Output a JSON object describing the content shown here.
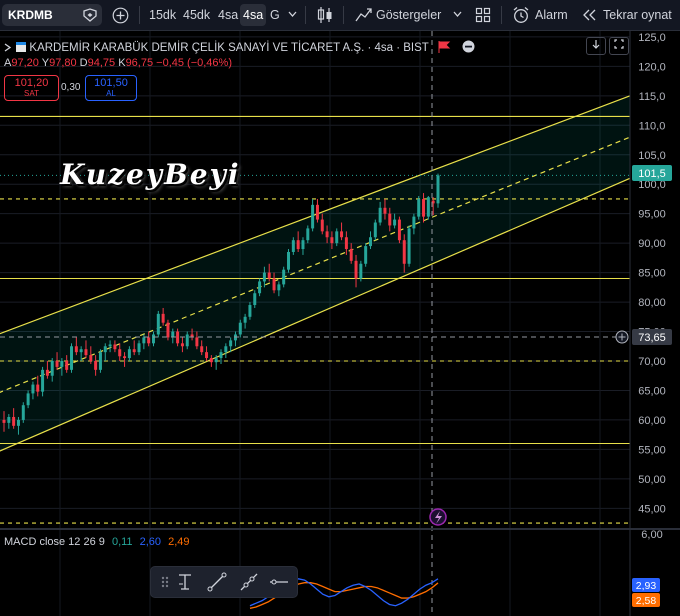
{
  "toolbar": {
    "symbol": "KRDMB",
    "intervals": [
      "15dk",
      "45dk",
      "4sa",
      "G"
    ],
    "active_interval": "4sa",
    "indicators_label": "Göstergeler",
    "alarm_label": "Alarm",
    "replay_label": "Tekrar oynat"
  },
  "legend": {
    "title": "KARDEMİR KARABÜK DEMİR ÇELİK SANAYİ VE TİCARET A.Ş. · 4sa · BIST",
    "ohlc": [
      {
        "k": "A",
        "v": "97,20"
      },
      {
        "k": "Y",
        "v": "97,80"
      },
      {
        "k": "D",
        "v": "94,75"
      },
      {
        "k": "K",
        "v": "96,75"
      }
    ],
    "change": "−0,45 (−0,46%)"
  },
  "trade": {
    "sell_price": "101,20",
    "sell_label": "SAT",
    "spread": "0,30",
    "buy_price": "101,50",
    "buy_label": "AL"
  },
  "watermark": "KuzeyBeyi",
  "price_axis": {
    "labels": [
      "125,0",
      "120,0",
      "115,0",
      "110,0",
      "105,0",
      "100,0",
      "95,00",
      "90,00",
      "85,00",
      "80,00",
      "75,00",
      "70,00",
      "65,00",
      "60,00",
      "55,00",
      "50,00",
      "45,00"
    ],
    "current_price": "101,5",
    "crosshair_price": "73,65"
  },
  "macd": {
    "label": "MACD close 12 26 9",
    "hist": "0,11",
    "macd": "2,60",
    "signal": "2,49",
    "axis_top": "6,00",
    "badge_blue": "2,93",
    "badge_orange": "2,58"
  },
  "colors": {
    "up": "#26a69a",
    "down": "#f23645",
    "level": "#e8e04a",
    "macd_line": "#2962ff",
    "signal_line": "#ff6d00"
  },
  "chart_data": {
    "type": "candlestick",
    "ylim": [
      42,
      126
    ],
    "horizontal_levels": [
      111.5,
      97.5,
      84,
      70,
      56,
      42.5
    ],
    "channel": {
      "upper": {
        "start": 74,
        "end": 115
      },
      "middle": {
        "start": 64,
        "end": 108
      },
      "lower": {
        "start": 54,
        "end": 101
      }
    },
    "candles": [
      [
        60,
        61.5,
        58,
        59.5
      ],
      [
        59.5,
        61,
        58.5,
        60.5
      ],
      [
        60.5,
        62,
        58.5,
        59
      ],
      [
        59,
        60.5,
        57.5,
        60
      ],
      [
        60,
        63,
        59.5,
        62.5
      ],
      [
        62.5,
        65,
        62,
        64.5
      ],
      [
        64.5,
        66.5,
        63.5,
        66
      ],
      [
        66,
        67.5,
        64,
        64.8
      ],
      [
        64.8,
        69,
        64,
        68.5
      ],
      [
        68.5,
        70,
        67,
        67.5
      ],
      [
        67.5,
        70.5,
        66.5,
        70
      ],
      [
        70,
        71.5,
        68.5,
        69
      ],
      [
        69,
        70.5,
        67.5,
        70
      ],
      [
        70,
        71,
        68,
        68.5
      ],
      [
        68.5,
        73,
        68,
        72.5
      ],
      [
        72.5,
        74,
        71,
        71.5
      ],
      [
        71.5,
        72.5,
        70,
        72
      ],
      [
        72,
        73.5,
        70.5,
        71
      ],
      [
        71,
        72.5,
        69.5,
        70
      ],
      [
        70,
        71,
        67.5,
        68.5
      ],
      [
        68.5,
        72,
        68,
        71.5
      ],
      [
        71.5,
        73,
        70,
        72.5
      ],
      [
        72.5,
        73.5,
        71.5,
        72.8
      ],
      [
        72.8,
        73.5,
        71.5,
        72
      ],
      [
        72,
        73,
        70,
        70.8
      ],
      [
        70.8,
        71.5,
        69,
        70.5
      ],
      [
        70.5,
        72.5,
        70,
        72
      ],
      [
        72,
        73.5,
        71,
        71.5
      ],
      [
        71.5,
        73.5,
        71,
        73
      ],
      [
        73,
        74.5,
        72,
        74
      ],
      [
        74,
        75,
        72.5,
        73
      ],
      [
        73,
        75,
        72.5,
        74.5
      ],
      [
        74.5,
        78.5,
        74,
        78
      ],
      [
        78,
        79,
        76,
        76.5
      ],
      [
        76.5,
        77,
        73.5,
        74
      ],
      [
        74,
        75.5,
        73,
        75
      ],
      [
        75,
        75.5,
        72.5,
        73
      ],
      [
        73,
        74,
        71.5,
        72.5
      ],
      [
        72.5,
        75,
        72,
        74.5
      ],
      [
        74.5,
        75.5,
        73.5,
        74
      ],
      [
        74,
        75,
        72,
        72.5
      ],
      [
        72.5,
        73.5,
        71,
        71.5
      ],
      [
        71.5,
        72.5,
        70,
        70.5
      ],
      [
        70.5,
        71,
        69,
        69.8
      ],
      [
        69.8,
        71,
        68.5,
        70.5
      ],
      [
        70.5,
        72,
        69.5,
        71.5
      ],
      [
        71.5,
        73,
        70.5,
        72.5
      ],
      [
        72.5,
        74,
        71.5,
        73.5
      ],
      [
        73.5,
        75,
        72.5,
        74.5
      ],
      [
        74.5,
        77,
        74,
        76.5
      ],
      [
        76.5,
        78,
        75.5,
        77.5
      ],
      [
        77.5,
        80,
        77,
        79.5
      ],
      [
        79.5,
        82,
        79,
        81.5
      ],
      [
        81.5,
        84,
        81,
        83.5
      ],
      [
        83.5,
        86,
        82.5,
        85
      ],
      [
        85,
        86.5,
        83.5,
        84
      ],
      [
        84,
        85,
        81.5,
        82
      ],
      [
        82,
        83.5,
        81,
        83
      ],
      [
        83,
        86,
        82.5,
        85.5
      ],
      [
        85.5,
        89,
        85,
        88.5
      ],
      [
        88.5,
        91,
        88,
        90.5
      ],
      [
        90.5,
        92,
        88.5,
        89
      ],
      [
        89,
        91,
        88,
        90.5
      ],
      [
        90.5,
        93,
        90,
        92.5
      ],
      [
        92.5,
        97.5,
        92,
        96.5
      ],
      [
        96.5,
        97.5,
        93.5,
        94
      ],
      [
        94,
        95,
        91.5,
        92
      ],
      [
        92,
        93,
        90,
        91
      ],
      [
        91,
        92,
        89,
        90
      ],
      [
        90,
        92.5,
        89.5,
        92
      ],
      [
        92,
        93.5,
        90.5,
        91
      ],
      [
        91,
        92,
        88,
        89
      ],
      [
        89,
        90,
        86.5,
        87
      ],
      [
        87,
        88,
        82.5,
        84
      ],
      [
        84,
        87,
        83.5,
        86.5
      ],
      [
        86.5,
        90,
        86,
        89.5
      ],
      [
        89.5,
        92,
        89,
        91
      ],
      [
        91,
        94,
        90.5,
        93.5
      ],
      [
        93.5,
        97,
        93,
        96
      ],
      [
        96,
        97.5,
        94,
        95
      ],
      [
        95,
        96,
        92,
        93
      ],
      [
        93,
        95,
        92.5,
        94
      ],
      [
        94,
        94.5,
        90,
        90.5
      ],
      [
        90.5,
        91.5,
        85,
        86.5
      ],
      [
        86.5,
        93,
        86,
        92.5
      ],
      [
        92.5,
        95,
        91.5,
        94.5
      ],
      [
        94.5,
        98,
        94,
        97.5
      ],
      [
        97.5,
        98.5,
        93.5,
        94.5
      ],
      [
        94.5,
        98,
        94,
        97.8
      ],
      [
        97.2,
        97.8,
        94.75,
        96.75
      ],
      [
        96.75,
        101.8,
        96,
        101.5
      ]
    ],
    "macd": {
      "macd_line": [
        0.8,
        1.0,
        1.2,
        1.5,
        1.9,
        2.3,
        2.6,
        2.8,
        2.9,
        2.8,
        2.5,
        2.1,
        1.7,
        1.5,
        1.6,
        1.9,
        2.2,
        2.4,
        2.5,
        2.3,
        2.0,
        1.6,
        1.2,
        0.9,
        0.8,
        1.0,
        1.3,
        1.7,
        2.1,
        2.4,
        2.6,
        2.9
      ],
      "signal_line": [
        0.6,
        0.7,
        0.9,
        1.1,
        1.4,
        1.7,
        2.0,
        2.3,
        2.5,
        2.6,
        2.6,
        2.5,
        2.3,
        2.1,
        1.9,
        1.9,
        2.0,
        2.1,
        2.2,
        2.3,
        2.3,
        2.2,
        2.0,
        1.8,
        1.6,
        1.4,
        1.4,
        1.5,
        1.7,
        1.9,
        2.2,
        2.58
      ]
    }
  }
}
